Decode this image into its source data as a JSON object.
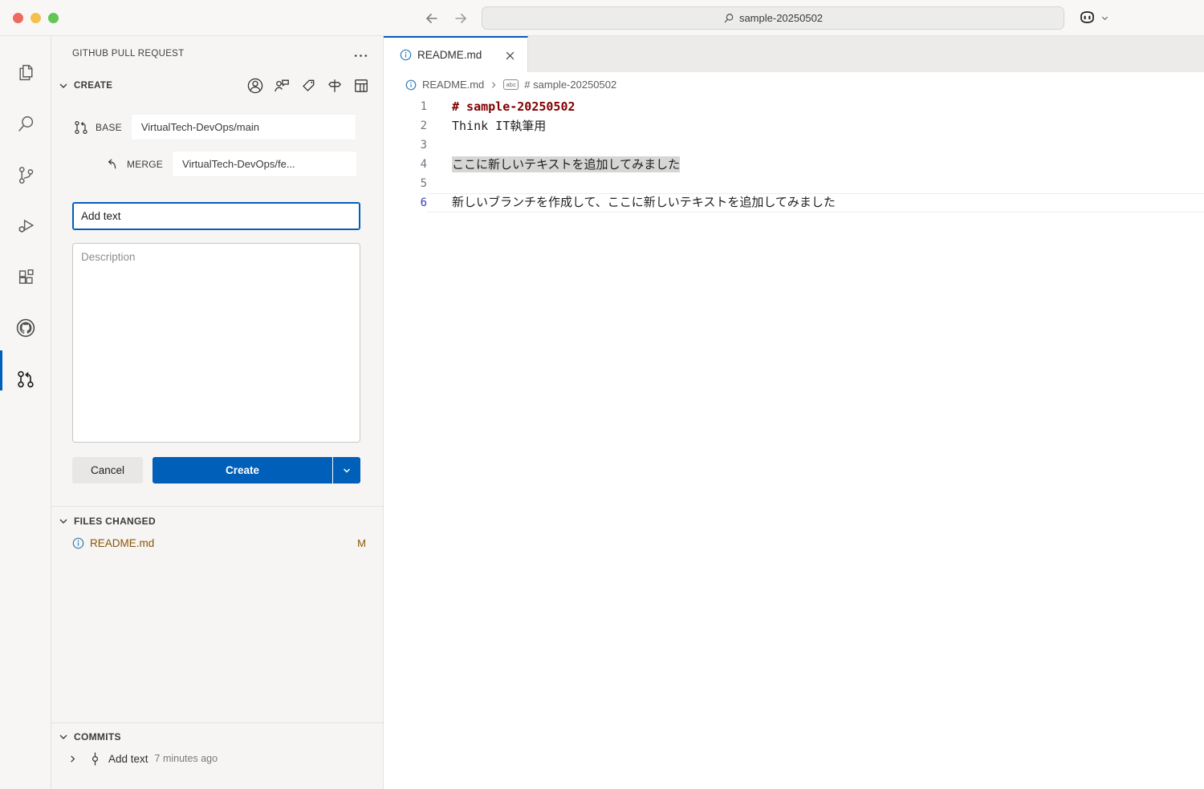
{
  "window": {
    "search_value": "sample-20250502",
    "traffic_lights": [
      "close",
      "minimize",
      "zoom"
    ],
    "titlebar_icons": [
      "arrow-left-icon",
      "arrow-right-icon",
      "search-icon",
      "copilot-icon",
      "chevron-down-icon"
    ]
  },
  "activity_bar": {
    "items": [
      {
        "name": "explorer",
        "icon": "files-icon",
        "active": false
      },
      {
        "name": "search",
        "icon": "search-icon",
        "active": false
      },
      {
        "name": "source-control",
        "icon": "branch-icon",
        "active": false
      },
      {
        "name": "run-and-debug",
        "icon": "debug-icon",
        "active": false
      },
      {
        "name": "extensions",
        "icon": "extensions-icon",
        "active": false
      },
      {
        "name": "github",
        "icon": "github-octocat-icon",
        "active": false
      },
      {
        "name": "github-pull-requests",
        "icon": "git-pull-request-icon",
        "active": true
      }
    ]
  },
  "sidebar": {
    "title": "GITHUB PULL REQUEST",
    "more_actions_icon": "ellipsis-icon",
    "create": {
      "label": "CREATE",
      "toolbar_icons": [
        "assignees-icon",
        "reviewers-icon",
        "labels-icon",
        "milestone-icon",
        "project-icon"
      ],
      "base_label": "BASE",
      "base_value": "VirtualTech-DevOps/main",
      "merge_label": "MERGE",
      "merge_value": "VirtualTech-DevOps/fe...",
      "title_value": "Add text",
      "description_placeholder": "Description",
      "cancel_label": "Cancel",
      "create_label": "Create"
    },
    "files_changed": {
      "label": "FILES CHANGED",
      "files": [
        {
          "name": "README.md",
          "status": "M",
          "icon": "info-icon"
        }
      ]
    },
    "commits": {
      "label": "COMMITS",
      "items": [
        {
          "message": "Add text",
          "time": "7 minutes ago",
          "icon": "git-commit-icon"
        }
      ]
    }
  },
  "editor": {
    "tab": {
      "title": "README.md",
      "icon": "info-icon",
      "close_icon": "close-icon"
    },
    "breadcrumb": {
      "file": "README.md",
      "symbol_badge": "abc",
      "symbol": "# sample-20250502"
    },
    "lines": [
      {
        "num": "1",
        "text": "# sample-20250502"
      },
      {
        "num": "2",
        "text": "Think IT執筆用"
      },
      {
        "num": "3",
        "text": ""
      },
      {
        "num": "4",
        "text": "ここに新しいテキストを追加してみました"
      },
      {
        "num": "5",
        "text": ""
      },
      {
        "num": "6",
        "text": "新しいブランチを作成して、ここに新しいテキストを追加してみました"
      }
    ]
  },
  "colors": {
    "accent_blue": "#005fb8",
    "modified_file": "#895503",
    "markdown_heading": "#800000",
    "selection_gray": "#d6d6d5",
    "active_line_number": "#3b3bbf",
    "sidebar_bg": "#f6f5f4",
    "tabbar_bg": "#ecebe9"
  }
}
